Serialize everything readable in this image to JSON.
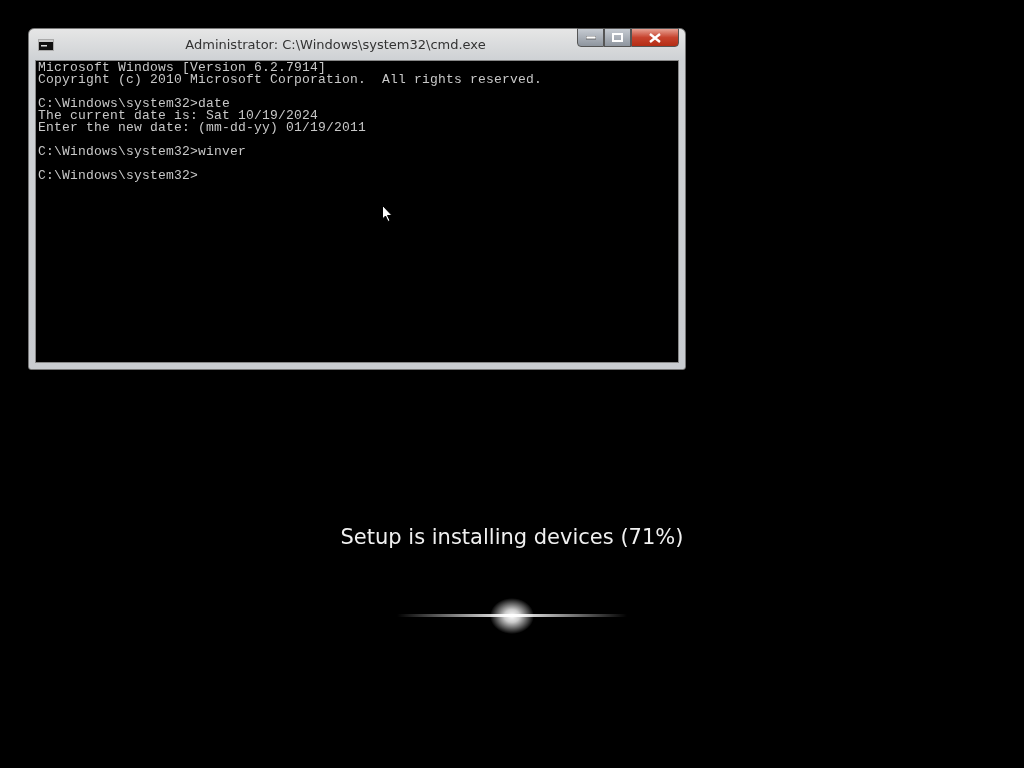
{
  "window": {
    "title": "Administrator: C:\\Windows\\system32\\cmd.exe"
  },
  "console": {
    "blocks": [
      [
        "Microsoft Windows [Version 6.2.7914]",
        "Copyright (c) 2010 Microsoft Corporation.  All rights reserved."
      ],
      [
        "C:\\Windows\\system32>date",
        "The current date is: Sat 10/19/2024",
        "Enter the new date: (mm-dd-yy) 01/19/2011"
      ],
      [
        "C:\\Windows\\system32>winver"
      ],
      [
        "C:\\Windows\\system32>"
      ]
    ]
  },
  "setup": {
    "status": "Setup is installing devices (71%)"
  }
}
